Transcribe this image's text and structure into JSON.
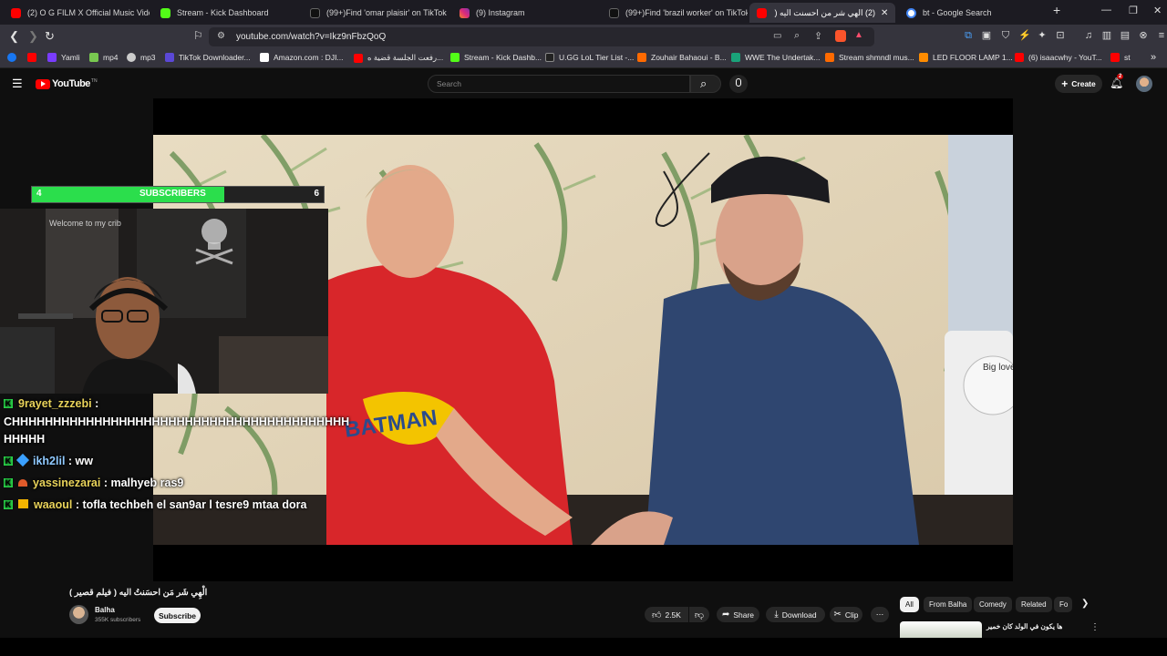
{
  "browser": {
    "tabs": [
      {
        "title": "(2) O G FILM X Official Music Vidéo",
        "favicon_color": "#ff0000",
        "active": false
      },
      {
        "title": "Stream - Kick Dashboard",
        "favicon_color": "#53fc18",
        "active": false
      },
      {
        "title": "(99+)Find 'omar plaisir' on TikTok | T",
        "favicon_color": "#111111",
        "active": false
      },
      {
        "title": "(9) Instagram",
        "favicon_color": "#d62976",
        "active": false
      },
      {
        "title": "(99+)Find 'brazil worker' on TikTok |",
        "favicon_color": "#111111",
        "active": false
      },
      {
        "title": "(2) الهي شر من احسنت اليه ( فيلم",
        "favicon_color": "#ff0000",
        "active": true
      },
      {
        "title": "bt - Google Search",
        "favicon_color": "#4285f4",
        "active": false
      }
    ],
    "url": "youtube.com/watch?v=Ikz9nFbzQoQ",
    "bookmarks": [
      {
        "label": "",
        "color": "#1877f2"
      },
      {
        "label": "",
        "color": "#ff0000"
      },
      {
        "label": "Yamli",
        "color": "#7a3cff"
      },
      {
        "label": "mp4",
        "color": "#78c850"
      },
      {
        "label": "mp3",
        "color": "#cccccc"
      },
      {
        "label": "TikTok Downloader...",
        "color": "#5b48d6"
      },
      {
        "label": "Amazon.com : DJI...",
        "color": "#ffffff"
      },
      {
        "label": "رفعت الجلسة قضية ه...",
        "color": "#ff0000"
      },
      {
        "label": "Stream - Kick Dashb...",
        "color": "#53fc18"
      },
      {
        "label": "U.GG LoL Tier List -...",
        "color": "#222222"
      },
      {
        "label": "Zouhair Bahaoui - B...",
        "color": "#ff6a00"
      },
      {
        "label": "WWE The Undertak...",
        "color": "#1aa37a"
      },
      {
        "label": "Stream shmndl mus...",
        "color": "#ff6a00"
      },
      {
        "label": "LED FLOOR LAMP 1...",
        "color": "#ff8c00"
      },
      {
        "label": "(6) isaacwhy - YouT...",
        "color": "#ff0000"
      },
      {
        "label": "st",
        "color": "#ff0000"
      }
    ]
  },
  "youtube": {
    "logo_text": "YouTube",
    "logo_sup": "TN",
    "search_placeholder": "Search",
    "create_label": "Create",
    "notif_count": "2"
  },
  "overlay": {
    "sub_current": "4",
    "sub_label": "SUBSCRIBERS",
    "sub_goal": "6",
    "sub_progress": 0.66,
    "webcam_sign": "Welcome to my crib",
    "chat": [
      {
        "user": "9rayet_zzzebi",
        "message": ""
      },
      {
        "user": "",
        "message": "CHHHHHHHHHHHHHHHHHHHHHHHHHHHHHHHHHHHHHHHHH"
      },
      {
        "user": "",
        "message": "HHHHH"
      },
      {
        "user": "ikh2lil",
        "message": "ww"
      },
      {
        "user": "yassinezarai",
        "message": "malhyeb ras9"
      },
      {
        "user": "waaoul",
        "message": "tofla techbeh el san9ar l tesre9 mtaa dora"
      }
    ]
  },
  "video": {
    "title": "الْهِي شَر مَن احسَنتُ اليه ( فيلم قصير )",
    "channel": "Balha",
    "subscribers": "355K subscribers",
    "subscribe_label": "Subscribe",
    "like_count": "2.5K",
    "share_label": "Share",
    "download_label": "Download",
    "clip_label": "Clip",
    "shirt_text": "BATMAN",
    "sign_text": "Big love"
  },
  "sidebar": {
    "chips": [
      "All",
      "From Balha",
      "Comedy",
      "Related",
      "Fo"
    ],
    "rec_title": "ها يكون في الولد كان خمير"
  }
}
